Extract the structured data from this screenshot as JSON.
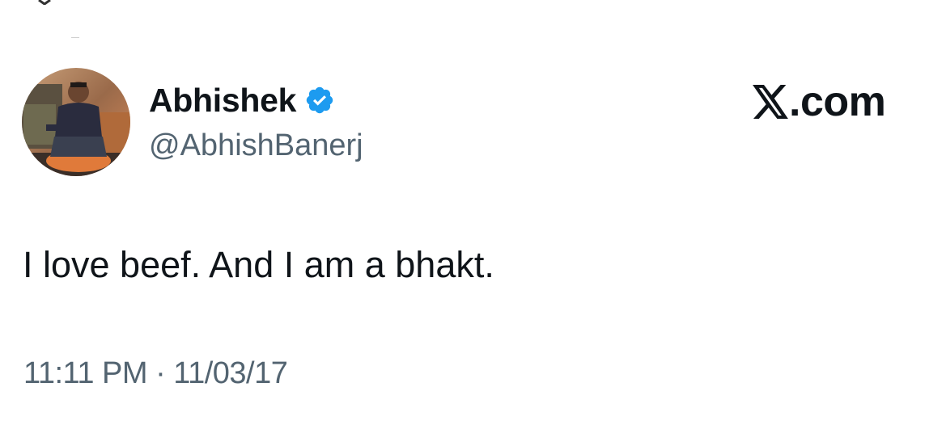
{
  "tweet": {
    "author": {
      "display_name": "Abhishek",
      "handle": "@AbhishBanerj",
      "verified": true,
      "avatar_icon": "profile-photo"
    },
    "brand": {
      "logo_icon": "x-logo-icon",
      "text": ".com"
    },
    "body_text": "I love beef. And I am a bhakt.",
    "timestamp": "11:11 PM · 11/03/17"
  },
  "colors": {
    "text_primary": "#0f1419",
    "text_secondary": "#536471",
    "verified_blue": "#1d9bf0",
    "background": "#ffffff"
  }
}
